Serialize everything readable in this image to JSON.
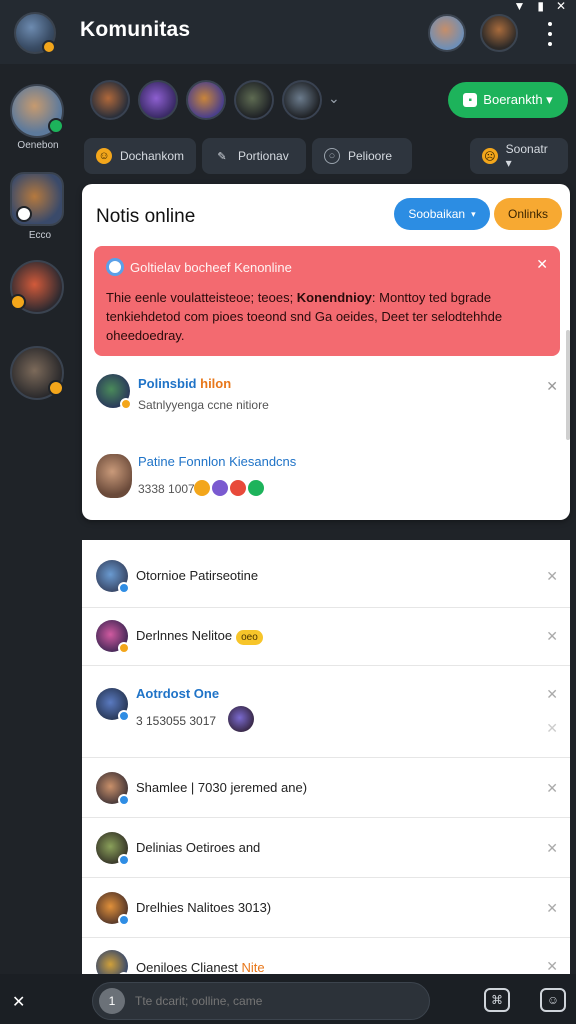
{
  "app": {
    "title": "Komunitas"
  },
  "status_icons": [
    "wifi-icon",
    "battery-icon",
    "close-icon"
  ],
  "rail": {
    "items": [
      {
        "label": "Oenebon"
      },
      {
        "label": "Ecco"
      }
    ]
  },
  "online_button": {
    "label": "Boerankth ▾"
  },
  "tabs": [
    {
      "label": "Dochankom"
    },
    {
      "label": "Portionav"
    },
    {
      "label": "Pelioore"
    },
    {
      "label": "Soonatr ▾"
    }
  ],
  "card": {
    "title": "Notis online",
    "pill_blue": "Soobaikan",
    "pill_orange": "Onlinks",
    "alert": {
      "heading": "Goltielav bocheef Kenonline",
      "body_pre": "Thie eenle voulatteisteoe; teoes; ",
      "body_bold": "Konendnioy",
      "body_post": ": Monttoy ted bgrade tenkiehdetod com pioes toeond snd Ga oeides, Deet ter selodtehhde oheedoedray."
    },
    "rows": [
      {
        "name": "Polinsbid",
        "name_accent": "hilon",
        "sub": "Satnlyyenga ccne nitiore"
      },
      {
        "name": "Patine Fonnlon Kiesandcns",
        "sub": "3338 1007"
      }
    ]
  },
  "list": [
    {
      "name": "Otornioe Patirseotine"
    },
    {
      "name": "Derlnnes Nelitoe",
      "tag": "oeo"
    },
    {
      "name": "Aotrdost One",
      "sub": "3 153055 3017"
    },
    {
      "name": "Shamlee | 7030 jeremed ane)"
    },
    {
      "name": "Delinias Oetiroes and"
    },
    {
      "name": "Drelhies Nalitoes 3013)"
    },
    {
      "name": "Oeniloes Clianest",
      "name_accent": "Nite"
    }
  ],
  "bottom": {
    "left": "✕",
    "compose_num": "1",
    "compose_placeholder": "Tte dcarit; oolline, came"
  },
  "colors": {
    "background": "#1f2328",
    "accent_green": "#1db35b",
    "accent_blue": "#2c8de3",
    "accent_orange": "#f7a932",
    "alert_red": "#f36a70"
  }
}
